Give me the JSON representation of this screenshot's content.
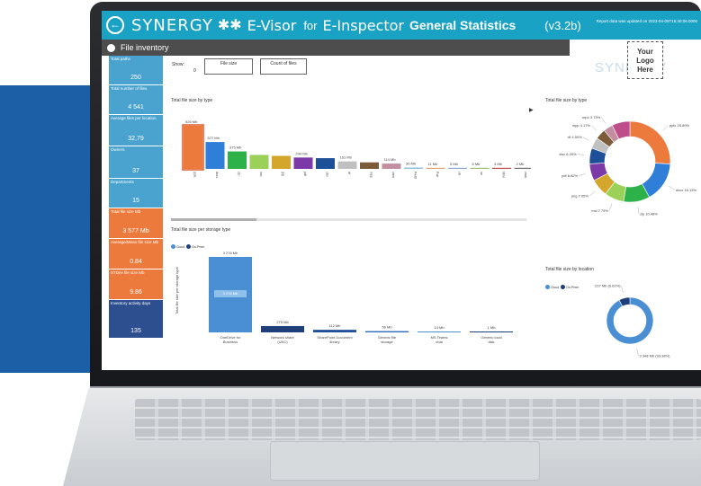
{
  "app": {
    "back_icon": "arrow-left-circle-icon",
    "brand": "SYNERGY",
    "brand_mark": "✱✱",
    "name_visor": "E-Visor",
    "for": "for",
    "name_inspector": "E-Inspector",
    "page_title": "General Statistics",
    "version": "(v3.2b)",
    "update_text": "Report data was updated on 2022-04-05T16:40:06.0000"
  },
  "section": {
    "title": "File inventory"
  },
  "logo": {
    "line1": "Your",
    "line2": "Logo",
    "line3": "Here",
    "bg_text": "SYNERGY"
  },
  "kpis": [
    {
      "label": "Total paths",
      "value": "250",
      "color": "#4aa3cf"
    },
    {
      "label": "Total number of files",
      "value": "4 541",
      "color": "#4aa3cf"
    },
    {
      "label": "Average files per location",
      "value": "32,79",
      "color": "#4aa3cf"
    },
    {
      "label": "Owners",
      "value": "37",
      "color": "#4aa3cf"
    },
    {
      "label": "Departments",
      "value": "15",
      "color": "#4aa3cf"
    },
    {
      "label": "Total file size Mb",
      "value": "3 577 Mb",
      "color": "#ec7a3c"
    },
    {
      "label": "Average/Mean file size Mb",
      "value": "0.84",
      "color": "#ec7a3c"
    },
    {
      "label": "STDev file size Mb",
      "value": "9.86",
      "color": "#ec7a3c"
    },
    {
      "label": "Inventory activity days",
      "value": "135",
      "color": "#2d4f90"
    }
  ],
  "controls": {
    "show_label": "Show:",
    "show_value": "0",
    "file_size_btn": "File size",
    "count_btn": "Count of files"
  },
  "file_type_chart": {
    "title": "Total file size by type",
    "legend_items": [
      "pptx",
      "docx",
      "zip",
      "msi",
      "jpg",
      "pdf",
      "xlsx",
      "rtf",
      "mpp",
      "xlsm",
      "png",
      "vsd",
      "Field",
      "Pub",
      "xls",
      "rar",
      "html",
      "vsdx",
      "txt"
    ],
    "legend_colors": [
      "#ec7a3c",
      "#2f7ed8",
      "#2db24a",
      "#9bd158",
      "#d4a72c",
      "#7c3aa8",
      "#1e4f99",
      "#c0c0c0",
      "#7b5b3a",
      "#c28ea0",
      "#bf4d8c",
      "#6b6b6b",
      "#91c7e3",
      "#e6a46b",
      "#8fa8d8",
      "#a0c070",
      "#c05050",
      "#707070",
      "#e03a3a"
    ],
    "bars": [
      {
        "label": "pptx",
        "value": 926,
        "display": "926 Mb",
        "color": "#ec7a3c"
      },
      {
        "label": "docx",
        "value": 577,
        "display": "577 Mb",
        "color": "#2f7ed8"
      },
      {
        "label": "zip",
        "value": 375,
        "display": "375 Mb",
        "color": "#2db24a"
      },
      {
        "label": "msi",
        "value": 300,
        "display": "",
        "color": "#9bd158"
      },
      {
        "label": "jpg",
        "value": 280,
        "display": "",
        "color": "#d4a72c"
      },
      {
        "label": "pdf",
        "value": 244,
        "display": "244 Mb",
        "color": "#7c3aa8"
      },
      {
        "label": "xlsx",
        "value": 230,
        "display": "",
        "color": "#1e4f99"
      },
      {
        "label": "rtf",
        "value": 161,
        "display": "161 Mb",
        "color": "#c0c0c0"
      },
      {
        "label": "mpp",
        "value": 140,
        "display": "",
        "color": "#7b5b3a"
      },
      {
        "label": "xlsm",
        "value": 114,
        "display": "114 Mb",
        "color": "#c28ea0"
      },
      {
        "label": "Field",
        "value": 30,
        "display": "30 Mb",
        "color": "#91c7e3"
      },
      {
        "label": "Pub",
        "value": 11,
        "display": "11 Mb",
        "color": "#e6a46b"
      },
      {
        "label": "xls",
        "value": 5,
        "display": "5 Mb",
        "color": "#8fa8d8"
      },
      {
        "label": "rar",
        "value": 5,
        "display": "5 Mb",
        "color": "#a0c070"
      },
      {
        "label": "html",
        "value": 3,
        "display": "3 Mb",
        "color": "#c05050"
      },
      {
        "label": "vsdx",
        "value": 2,
        "display": "2 Mb",
        "color": "#707070"
      }
    ]
  },
  "storage_chart": {
    "title": "Total file size per storage type",
    "legend": [
      {
        "label": "Cloud",
        "color": "#4a8fd4"
      },
      {
        "label": "On-Prem",
        "color": "#1e3f7a"
      }
    ],
    "ylabel": "Total file size per storage type",
    "bars": [
      {
        "label": "OneDrive for Business",
        "value": 3276,
        "display": "3 276 Mb",
        "color": "#4a8fd4"
      },
      {
        "label": "Network share (UNC)",
        "value": 275,
        "display": "275 Mb",
        "color": "#1e3f7a"
      },
      {
        "label": "SharePoint Document library",
        "value": 112,
        "display": "112 Mb",
        "color": "#1e4f99"
      },
      {
        "label": "Generic file storage",
        "value": 56,
        "display": "56 Mb",
        "color": "#2f6fb8"
      },
      {
        "label": "MS Teams chat",
        "value": 14,
        "display": "14 Mb",
        "color": "#4a8fd4"
      },
      {
        "label": "Generic local disk",
        "value": 1,
        "display": "1 Mb",
        "color": "#1e3f7a"
      }
    ]
  },
  "type_donut": {
    "title": "Total file size by type",
    "slices": [
      {
        "label": "pptx",
        "value": 25.89,
        "display": "pptx 25.89%",
        "color": "#ec7a3c"
      },
      {
        "label": "docx",
        "value": 16.13,
        "display": "docx 16.13%",
        "color": "#2f7ed8"
      },
      {
        "label": "zip",
        "value": 10.48,
        "display": "zip 10.48%",
        "color": "#2db24a"
      },
      {
        "label": "msi",
        "value": 7.79,
        "display": "msi 7.79%",
        "color": "#9bd158"
      },
      {
        "label": "png",
        "value": 7.05,
        "display": "png 7.05%",
        "color": "#d4a72c"
      },
      {
        "label": "pdf",
        "value": 6.82,
        "display": "pdf 6.82%",
        "color": "#7c3aa8"
      },
      {
        "label": "xlsx",
        "value": 6.25,
        "display": "xlsx 6.25%",
        "color": "#1e4f99"
      },
      {
        "label": "rtf",
        "value": 4.5,
        "display": "rtf 4.50%",
        "color": "#c0c0c0"
      },
      {
        "label": "mpp",
        "value": 4.17,
        "display": "mpp 4.17%",
        "color": "#7b5b3a"
      },
      {
        "label": "mp4",
        "value": 3.73,
        "display": "mp4 3.73%",
        "color": "#c28ea0"
      },
      {
        "label": "other",
        "value": 7.19,
        "display": "",
        "color": "#bf4d8c"
      }
    ]
  },
  "location_donut": {
    "title": "Total file size by location",
    "legend": [
      {
        "label": "Cloud",
        "color": "#4a8fd4"
      },
      {
        "label": "On-Prem",
        "color": "#1e3f7a"
      }
    ],
    "slices": [
      {
        "label": "Cloud",
        "value": 92.38,
        "display": "3 348 Mb (93.38%)",
        "color": "#4a8fd4"
      },
      {
        "label": "On-Prem",
        "value": 7.62,
        "display": "237 Mb (6.62%)",
        "color": "#1e3f7a"
      }
    ]
  }
}
